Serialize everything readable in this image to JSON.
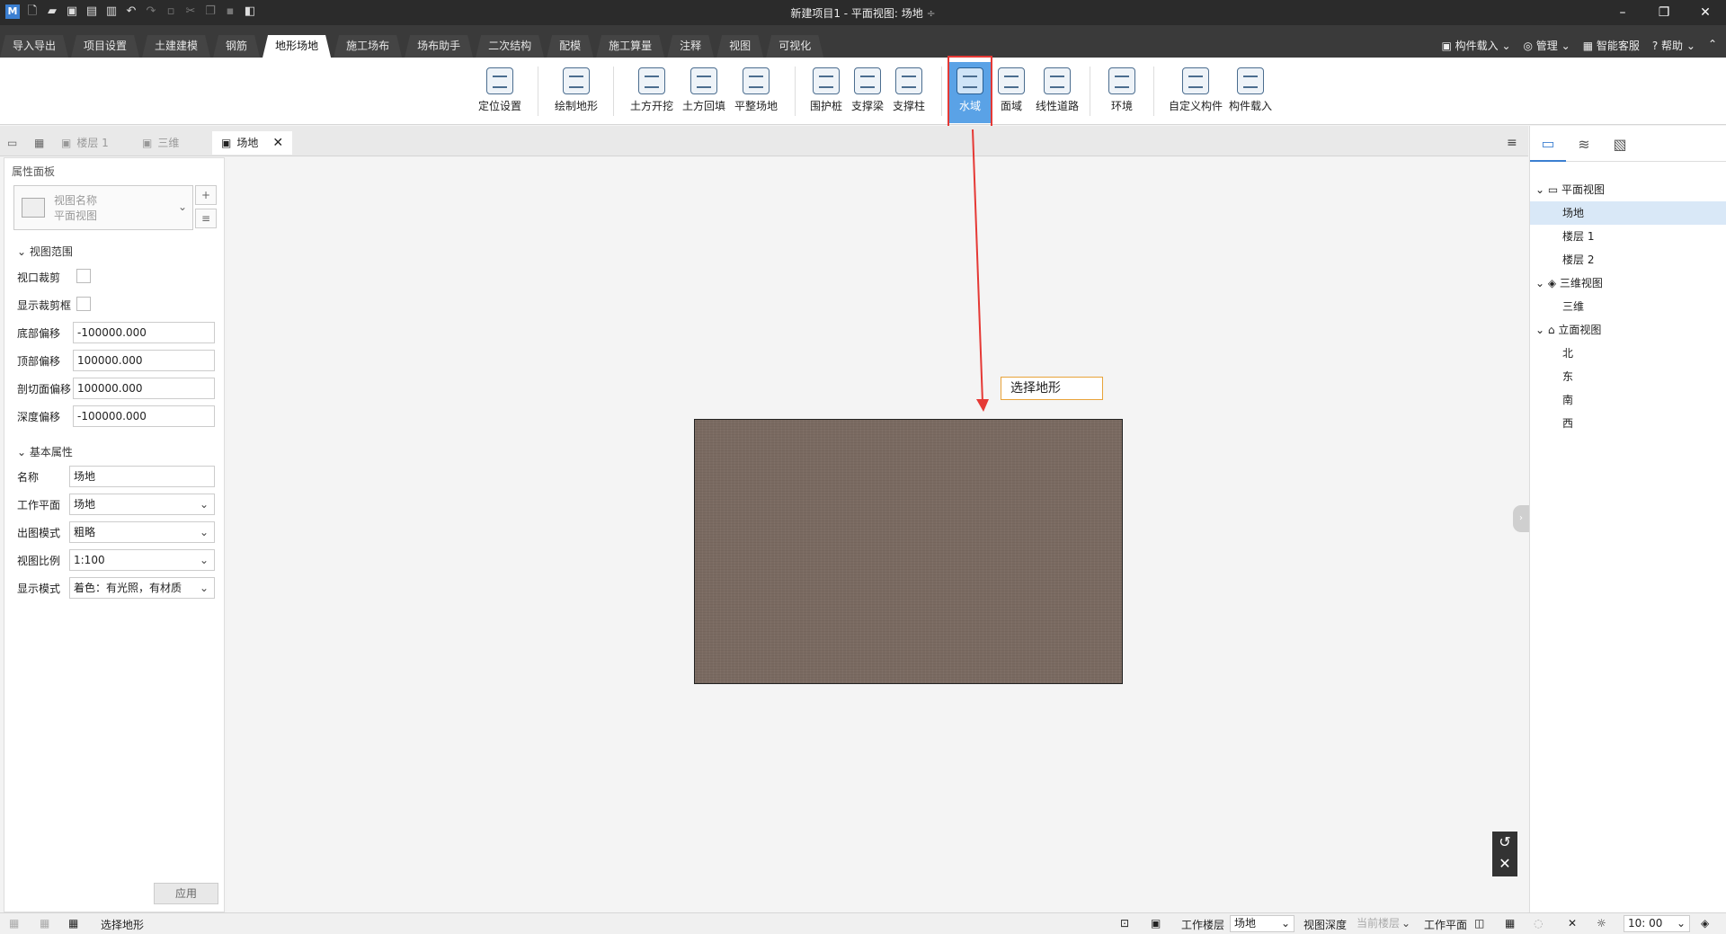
{
  "window": {
    "title": "新建项目1 - 平面视图: 场地",
    "title_arrow": "÷",
    "minimize": "–",
    "restore": "❐",
    "close": "✕"
  },
  "menu_tabs": [
    "导入导出",
    "项目设置",
    "土建建模",
    "钢筋",
    "地形场地",
    "施工场布",
    "场布助手",
    "二次结构",
    "配模",
    "施工算量",
    "注释",
    "视图",
    "可视化"
  ],
  "menu_active": "地形场地",
  "menu_right": {
    "load": "构件载入",
    "manage": "管理",
    "service": "智能客服",
    "help": "帮助"
  },
  "ribbon": {
    "locate": "定位设置",
    "draw_terrain": "绘制地形",
    "excavate": "土方开挖",
    "backfill": "土方回填",
    "level": "平整场地",
    "fence_pile": "围护桩",
    "support_beam": "支撑梁",
    "support_col": "支撑柱",
    "water": "水域",
    "surface": "面域",
    "road": "线性道路",
    "env": "环境",
    "custom": "自定义构件",
    "load": "构件载入"
  },
  "doc_tabs": {
    "floor1": "楼层 1",
    "threed": "三维",
    "site": "场地"
  },
  "props": {
    "panel_title": "属性面板",
    "view_name_label": "视图名称",
    "view_name_value": "平面视图",
    "sec_range": "视图范围",
    "crop": "视口裁剪",
    "show_crop": "显示裁剪框",
    "bottom_offset_lbl": "底部偏移",
    "bottom_offset": "-100000.000",
    "top_offset_lbl": "顶部偏移",
    "top_offset": "100000.000",
    "cut_offset_lbl": "剖切面偏移",
    "cut_offset": "100000.000",
    "depth_offset_lbl": "深度偏移",
    "depth_offset": "-100000.000",
    "sec_basic": "基本属性",
    "name_lbl": "名称",
    "name": "场地",
    "workplane_lbl": "工作平面",
    "workplane": "场地",
    "output_lbl": "出图模式",
    "output": "粗略",
    "scale_lbl": "视图比例",
    "scale": "1:100",
    "display_lbl": "显示模式",
    "display": "着色：有光照，有材质",
    "apply": "应用"
  },
  "canvas": {
    "tooltip": "选择地形"
  },
  "tree": {
    "plan": "平面视图",
    "site": "场地",
    "floor1": "楼层 1",
    "floor2": "楼层 2",
    "view3d": "三维视图",
    "threed": "三维",
    "elev": "立面视图",
    "north": "北",
    "east": "东",
    "south": "南",
    "west": "西"
  },
  "status": {
    "prompt": "选择地形",
    "work_floor_lbl": "工作楼层",
    "work_floor": "场地",
    "view_depth_lbl": "视图深度",
    "view_depth": "当前楼层",
    "work_plane_lbl": "工作平面",
    "time": "10: 00"
  },
  "colors": {
    "accent": "#5aa2e6",
    "highlight": "#e53935",
    "terrain": "#7a6a61"
  }
}
